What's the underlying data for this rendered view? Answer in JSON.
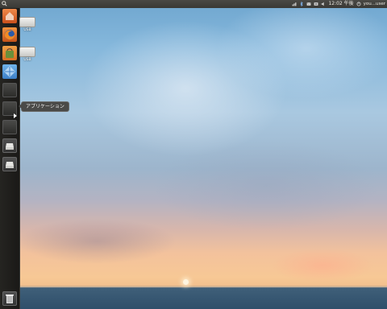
{
  "top_panel": {
    "clock": "12:02 午後",
    "user": "you...user",
    "indicator_icons": [
      "network-icon",
      "bluetooth-icon",
      "mail-icon",
      "keyboard-icon",
      "volume-icon"
    ]
  },
  "launcher": {
    "items": [
      {
        "name": "home"
      },
      {
        "name": "firefox"
      },
      {
        "name": "software-center"
      },
      {
        "name": "workspace-switcher"
      },
      {
        "name": "application"
      },
      {
        "name": "application"
      },
      {
        "name": "application"
      },
      {
        "name": "drive"
      },
      {
        "name": "drive"
      },
      {
        "name": "trash"
      }
    ],
    "tooltip": "アプリケーション"
  },
  "desktop": {
    "icons": [
      {
        "label": "USB"
      },
      {
        "label": "USB"
      }
    ]
  },
  "colors": {
    "panel": "#3f3e3a",
    "launcher": "#1f1e1b",
    "accent_orange": "#dd6a2b"
  }
}
